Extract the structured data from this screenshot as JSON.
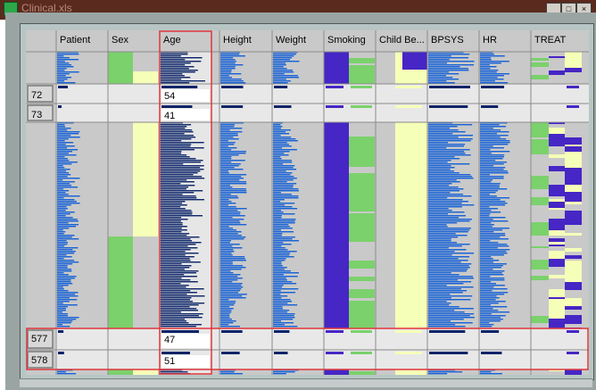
{
  "window": {
    "title": "Clinical.xls",
    "buttons": [
      "_",
      "□",
      "×"
    ]
  },
  "columns": [
    "Patient",
    "Sex",
    "Age",
    "Height",
    "Weight",
    "Smoking",
    "Child Be...",
    "BPSYS",
    "HR",
    "TREAT"
  ],
  "selected_column": "Age",
  "focus_rows": [
    {
      "row": "72",
      "age": "54"
    },
    {
      "row": "73",
      "age": "41"
    },
    {
      "row": "577",
      "age": "47"
    },
    {
      "row": "578",
      "age": "51"
    }
  ],
  "colors": {
    "dark_navy": "#0b2468",
    "blue": "#1560d6",
    "purple": "#4626c4",
    "green": "#7bd16c",
    "yellow": "#f6ffb8",
    "highlight_red": "#e0353b",
    "cell_gray": "#c9c9c9",
    "row_bg": "#e8e8e8"
  }
}
